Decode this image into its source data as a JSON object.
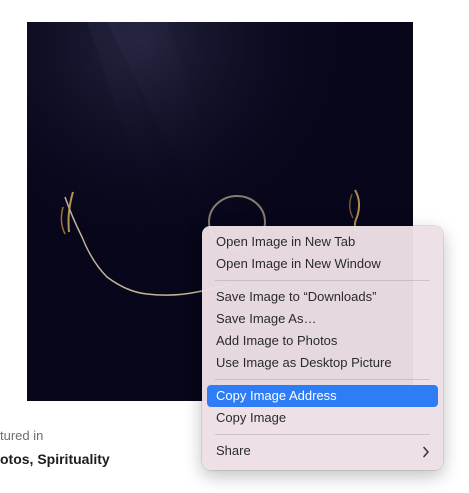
{
  "caption": {
    "prefix": "tured in",
    "tags": "otos, Spirituality"
  },
  "context_menu": {
    "group1": [
      {
        "label": "Open Image in New Tab"
      },
      {
        "label": "Open Image in New Window"
      }
    ],
    "group2": [
      {
        "label": "Save Image to “Downloads”"
      },
      {
        "label": "Save Image As…"
      },
      {
        "label": "Add Image to Photos"
      },
      {
        "label": "Use Image as Desktop Picture"
      }
    ],
    "group3": [
      {
        "label": "Copy Image Address",
        "highlighted": true
      },
      {
        "label": "Copy Image"
      }
    ],
    "group4": [
      {
        "label": "Share",
        "submenu_icon": "chevron-right-icon"
      }
    ]
  },
  "colors": {
    "photo_background": "#07061a",
    "menu_highlight": "#2f7df6"
  }
}
